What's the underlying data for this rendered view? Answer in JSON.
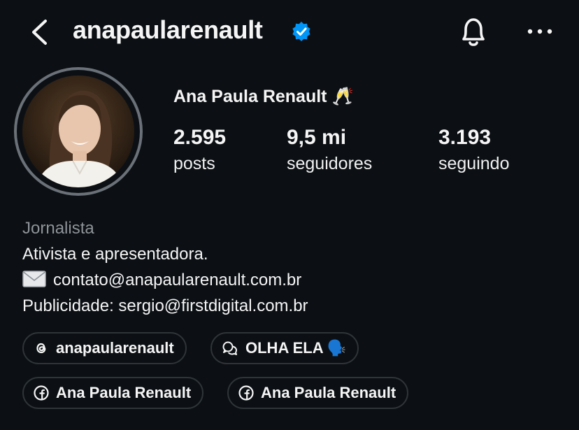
{
  "header": {
    "username": "anapaularenault"
  },
  "profile": {
    "display_name": "Ana Paula Renault 🥂",
    "stats": [
      {
        "value": "2.595",
        "label": "posts"
      },
      {
        "value": "9,5 mi",
        "label": "seguidores"
      },
      {
        "value": "3.193",
        "label": "seguindo"
      }
    ],
    "bio": {
      "category": "Jornalista",
      "line1": "Ativista e apresentadora.",
      "email": "contato@anapaularenault.com.br",
      "line3": "Publicidade: sergio@firstdigital.com.br"
    }
  },
  "links": [
    {
      "label": "anapaularenault",
      "icon": "threads-icon"
    },
    {
      "label": "OLHA ELA 🗣️",
      "icon": "chat-bubbles-icon"
    },
    {
      "label": "Ana Paula Renault",
      "icon": "facebook-icon"
    },
    {
      "label": "Ana Paula Renault",
      "icon": "facebook-icon"
    }
  ],
  "colors": {
    "background": "#0c1014",
    "text": "#f5f5f5",
    "muted": "#8e9399",
    "verified": "#0095f6",
    "pill_border": "#2f3439"
  }
}
